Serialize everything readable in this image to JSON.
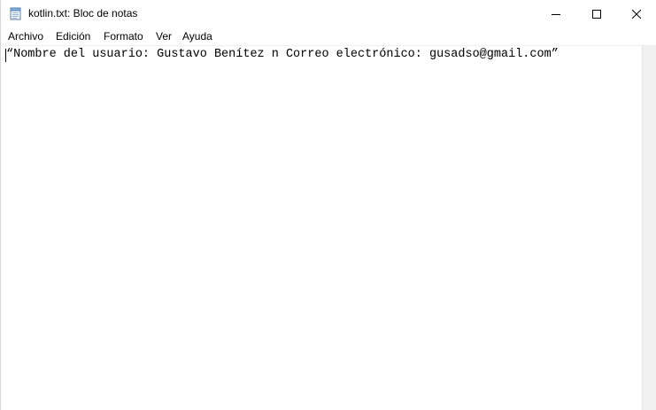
{
  "window": {
    "title": "kotlin.txt: Bloc de notas",
    "icon": "notepad-icon"
  },
  "caption_buttons": {
    "minimize_icon": "minimize-icon",
    "maximize_icon": "maximize-icon",
    "close_icon": "close-icon"
  },
  "menu": {
    "items": [
      {
        "label": "Archivo"
      },
      {
        "label": "Edición"
      },
      {
        "label": "Formato"
      },
      {
        "label": "Ver"
      },
      {
        "label": "Ayuda"
      }
    ]
  },
  "editor": {
    "content": "“Nombre del usuario: Gustavo Benítez n Correo electrónico: gusadso@gmail.com”"
  },
  "colors": {
    "background": "#ffffff",
    "scrollbar": "#f0f0f0",
    "text": "#000000"
  }
}
